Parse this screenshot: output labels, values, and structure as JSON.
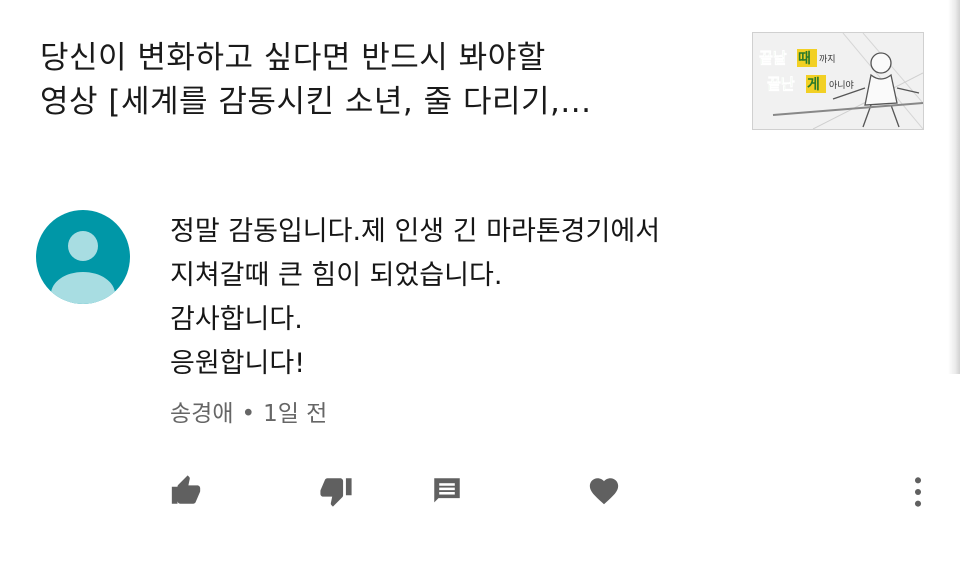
{
  "video": {
    "title_line1": "당신이 변화하고 싶다면 반드시 봐야할",
    "title_line2": "영상 [세계를 감동시킨 소년, 줄 다리기,...",
    "thumbnail": {
      "text_line1_a": "끝날",
      "text_line1_b": "때",
      "text_line1_c": "까지",
      "text_line2_a": "끝난",
      "text_line2_b": "게",
      "text_line2_c": "아니야",
      "accent_green": "#3aa63a",
      "accent_yellow": "#f2d024"
    }
  },
  "comment": {
    "lines": [
      "정말 감동입니다.제 인생 긴 마라톤경기에서",
      "지쳐갈때 큰 힘이 되었습니다.",
      "감사합니다.",
      "응원합니다!"
    ],
    "author": "송경애",
    "separator": "•",
    "time": "1일 전",
    "avatar_color": "#0097a7"
  },
  "actions": {
    "icons": [
      "thumbs-up-icon",
      "thumbs-down-icon",
      "reply-icon",
      "heart-icon",
      "more-vert-icon"
    ],
    "icon_color": "#606060"
  }
}
